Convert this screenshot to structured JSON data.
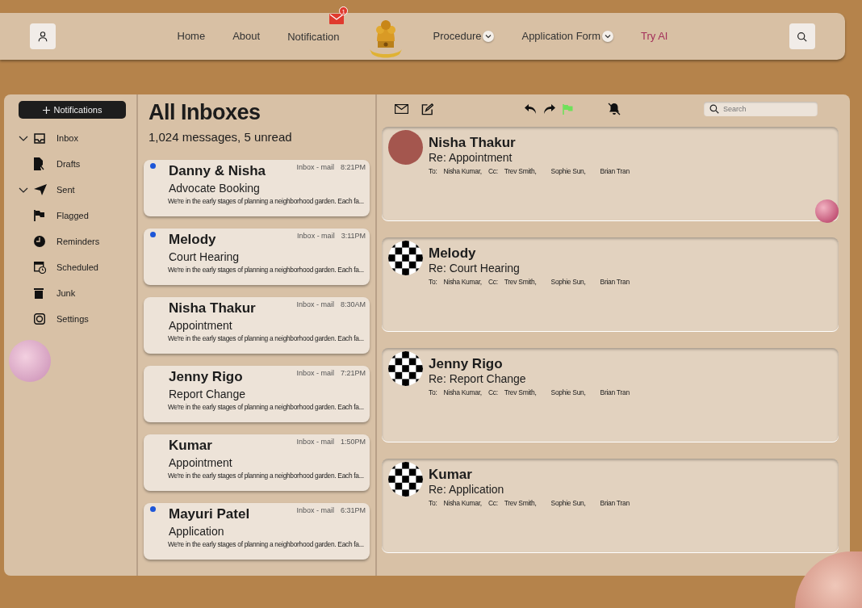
{
  "navbar": {
    "links": [
      {
        "label": "Home",
        "kind": "link"
      },
      {
        "label": "About",
        "kind": "link"
      },
      {
        "label": "Notification",
        "kind": "link",
        "badge": "1"
      },
      {
        "label": "Procedure",
        "kind": "dropdown"
      },
      {
        "label": "Application Form",
        "kind": "dropdown"
      },
      {
        "label": "Try AI",
        "kind": "accent"
      }
    ]
  },
  "sidebar": {
    "compose_button": "Notifications",
    "folders": [
      {
        "label": "Inbox",
        "kind": "group",
        "expanded": true
      },
      {
        "label": "Drafts",
        "kind": "folder"
      },
      {
        "label": "Sent",
        "kind": "group",
        "expanded": true
      },
      {
        "label": "Flagged",
        "kind": "folder"
      },
      {
        "label": "Reminders",
        "kind": "folder"
      },
      {
        "label": "Scheduled",
        "kind": "folder"
      },
      {
        "label": "Junk",
        "kind": "folder"
      },
      {
        "label": "Settings",
        "kind": "folder"
      }
    ]
  },
  "message_list": {
    "title": "All Inboxes",
    "subtitle": "1,024 messages, 5 unread",
    "messages": [
      {
        "sender": "Danny & Nisha",
        "subject": "Advocate Booking",
        "mailbox": "Inbox - mail",
        "time": "8:21PM",
        "preview": "We're in the early stages of planning a neighborhood garden. Each fa...",
        "unread": true
      },
      {
        "sender": "Melody",
        "subject": "Court Hearing",
        "mailbox": "Inbox - mail",
        "time": "3:11PM",
        "preview": "We're in the early stages of planning a neighborhood garden. Each fa...",
        "unread": true
      },
      {
        "sender": "Nisha Thakur",
        "subject": "Appointment",
        "mailbox": "Inbox - mail",
        "time": "8:30AM",
        "preview": "We're in the early stages of planning a neighborhood garden. Each fa...",
        "unread": false
      },
      {
        "sender": "Jenny Rigo",
        "subject": "Report Change",
        "mailbox": "Inbox - mail",
        "time": "7:21PM",
        "preview": "We're in the early stages of planning a neighborhood garden. Each fa...",
        "unread": false
      },
      {
        "sender": "Kumar",
        "subject": "Appointment",
        "mailbox": "Inbox - mail",
        "time": "1:50PM",
        "preview": "We're in the early stages of planning a neighborhood garden. Each fa...",
        "unread": false
      },
      {
        "sender": "Mayuri Patel",
        "subject": "Application",
        "mailbox": "Inbox - mail",
        "time": "6:31PM",
        "preview": "We're in the early stages of planning a neighborhood garden. Each fa...",
        "unread": true
      }
    ]
  },
  "reading_pane": {
    "search": {
      "placeholder": "Search"
    },
    "threads": [
      {
        "kind": "photo",
        "sender": "Nisha Thakur",
        "subject": "Re: Appointment",
        "to_label": "To:",
        "to": "Nisha Kumar,",
        "cc_label": "Cc:",
        "cc": [
          "Trev Smith,",
          "Sophie Sun,",
          "Brian Tran"
        ]
      },
      {
        "kind": "pattern",
        "sender": "Melody",
        "subject": "Re: Court Hearing",
        "to_label": "To:",
        "to": "Nisha Kumar,",
        "cc_label": "Cc:",
        "cc": [
          "Trev Smith,",
          "Sophie Sun,",
          "Brian Tran"
        ]
      },
      {
        "kind": "pattern",
        "sender": "Jenny Rigo",
        "subject": "Re: Report Change",
        "to_label": "To:",
        "to": "Nisha Kumar,",
        "cc_label": "Cc:",
        "cc": [
          "Trev Smith,",
          "Sophie Sun,",
          "Brian Tran"
        ]
      },
      {
        "kind": "pattern",
        "sender": "Kumar",
        "subject": "Re: Application",
        "to_label": "To:",
        "to": "Nisha Kumar,",
        "cc_label": "Cc:",
        "cc": [
          "Trev Smith,",
          "Sophie Sun,",
          "Brian Tran"
        ]
      }
    ]
  }
}
